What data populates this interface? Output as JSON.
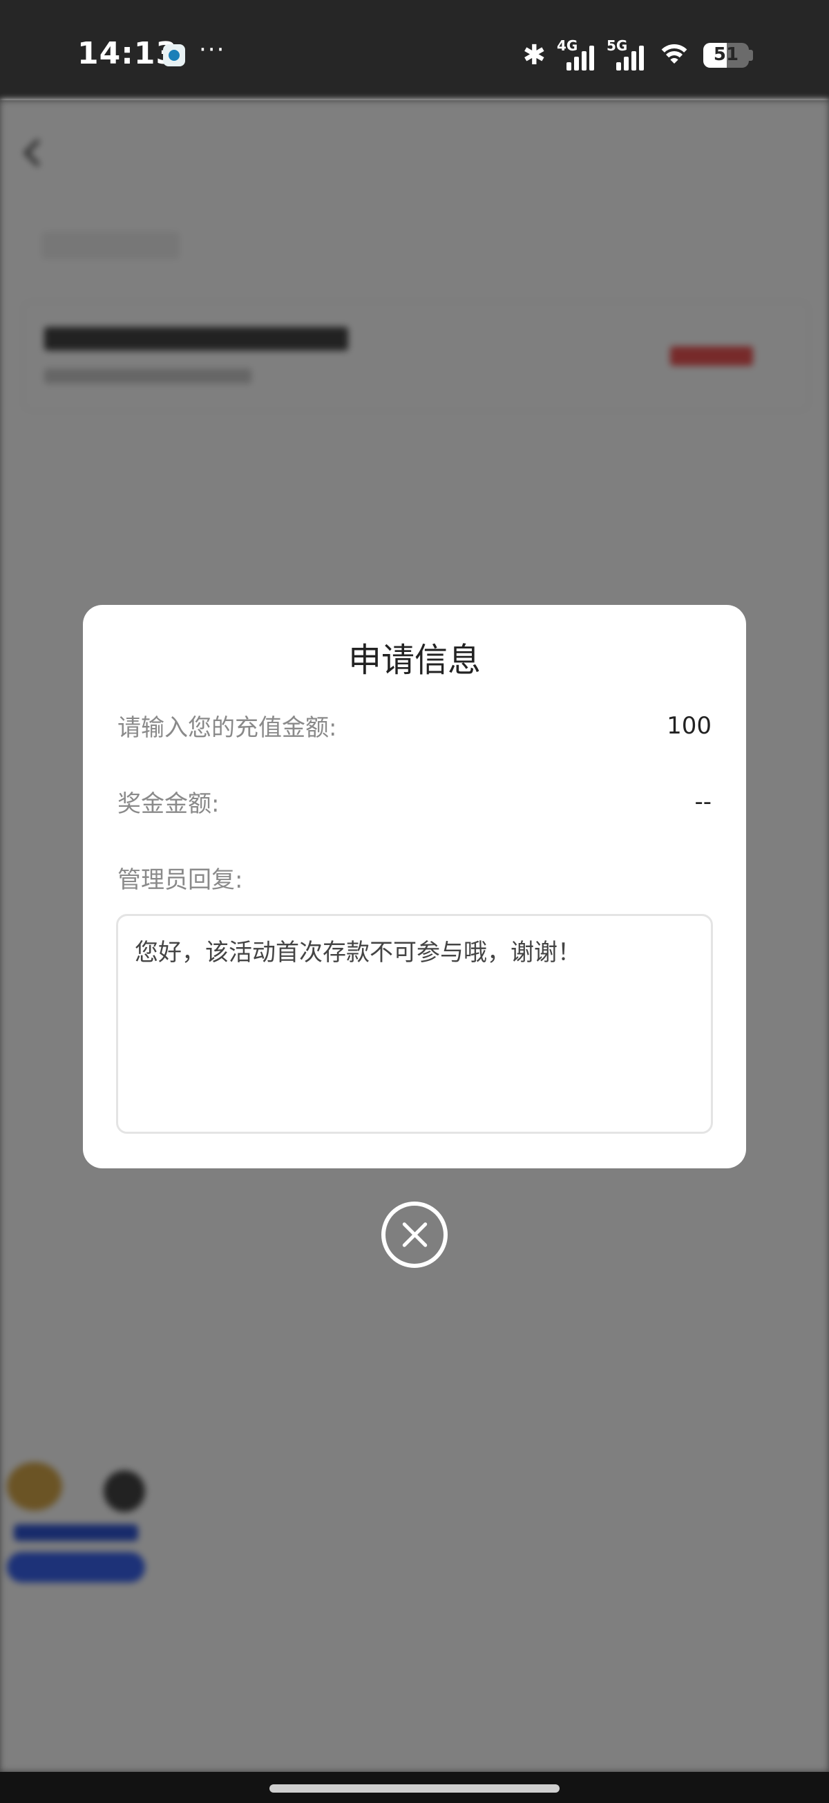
{
  "status_bar": {
    "time": "14:13",
    "app_icon": "browser-app-icon",
    "more": "···",
    "network_1": "4G",
    "network_2": "5G",
    "battery_level": "51"
  },
  "background_page": {
    "title": "",
    "back_icon": "chevron-left-icon"
  },
  "dialog": {
    "title": "申请信息",
    "recharge_label": "请输入您的充值金额:",
    "recharge_value": "100",
    "bonus_label": "奖金金额:",
    "bonus_value": "--",
    "reply_label": "管理员回复:",
    "reply_text": "您好，该活动首次存款不可参与哦，谢谢！"
  },
  "close_icon": "close-circle-icon",
  "colors": {
    "overlay": "#7f7f7f",
    "dialog_bg": "#ffffff",
    "label": "#8a8a8a",
    "value": "#222222",
    "status_bar": "#262626"
  }
}
